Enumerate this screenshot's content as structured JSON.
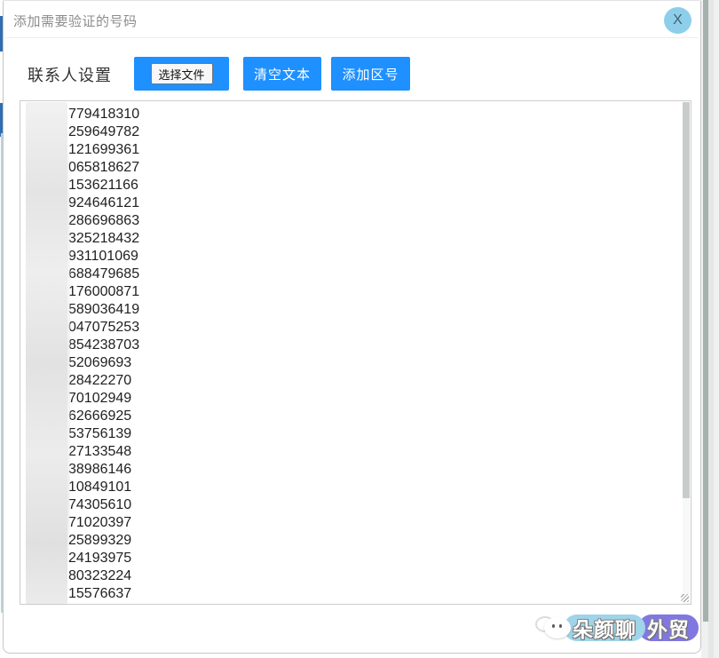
{
  "dialog": {
    "title": "添加需要验证的号码",
    "close_label": "X"
  },
  "toolbar": {
    "section_label": "联系人设置",
    "file_button_label": "选择文件",
    "clear_button_label": "清空文本",
    "area_code_button_label": "添加区号"
  },
  "numbers": {
    "lines": [
      "779418310",
      "259649782",
      "121699361",
      "065818627",
      "153621166",
      "924646121",
      "286696863",
      "325218432",
      "931101069",
      "688479685",
      "176000871",
      "589036419",
      "047075253",
      "854238703",
      "52069693",
      "28422270",
      "70102949",
      "62666925",
      "53756139",
      "27133548",
      "38986146",
      "10849101",
      "74305610",
      "71020397",
      "25899329",
      "24193975",
      "80323224",
      "15576637"
    ]
  },
  "watermark": {
    "brand_left": "朵颜聊",
    "brand_right": "外贸"
  },
  "colors": {
    "primary_blue": "#1E90FF",
    "close_button_bg": "#8DCFEA",
    "close_x": "#44606E",
    "title_gray": "#8C8C8C",
    "text_dark": "#1F1F1F",
    "watermark_blue": "#9FD4E9",
    "watermark_purple": "#8177E3"
  }
}
